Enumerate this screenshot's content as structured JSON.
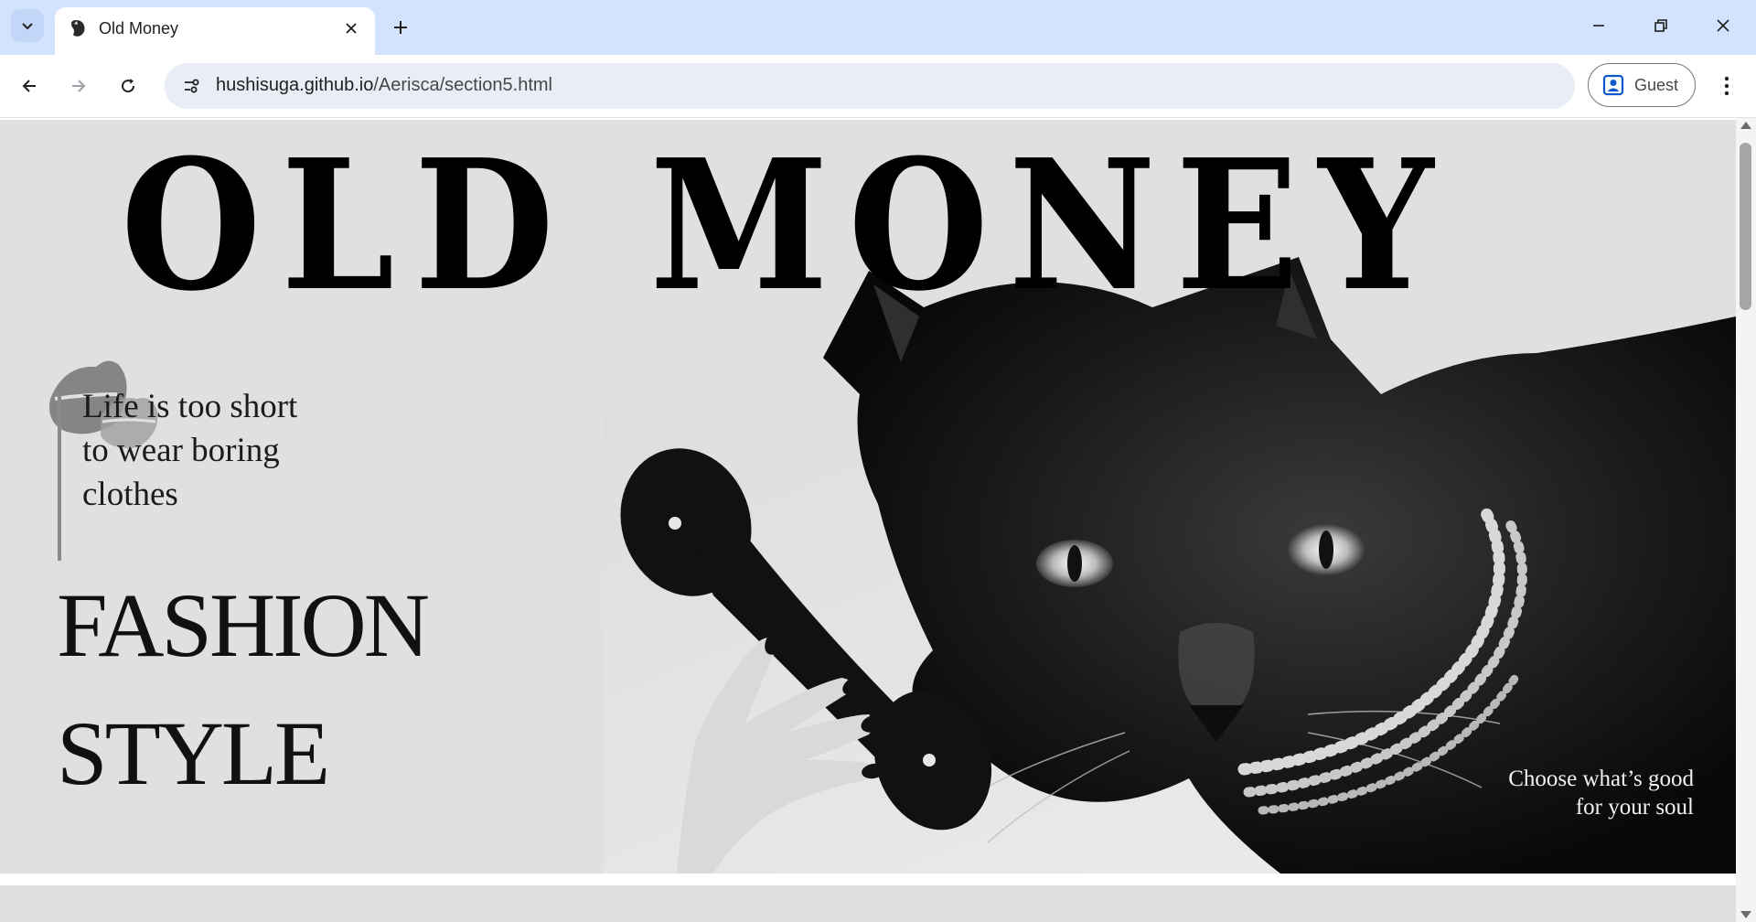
{
  "browser": {
    "tab_title": "Old Money",
    "url_host": "hushisuga.github.io",
    "url_path": "/Aerisca/section5.html",
    "profile_label": "Guest",
    "icons": [
      "tab-search-icon",
      "favicon-icon",
      "close-icon",
      "plus-icon",
      "minimize-icon",
      "restore-icon",
      "window-close-icon",
      "back-icon",
      "forward-icon",
      "reload-icon",
      "site-info-icon",
      "profile-icon",
      "kebab-menu-icon"
    ]
  },
  "hero": {
    "title": "OLD MONEY",
    "quote": "Life is too short to wear boring clothes",
    "word1": "FASHION",
    "word2": "STYLE",
    "caption": "Choose what’s good for your soul"
  },
  "colors": {
    "tabbar_bg": "#d3e3fd",
    "hero_bg": "#e0e0e0",
    "text_dark": "#111111"
  }
}
